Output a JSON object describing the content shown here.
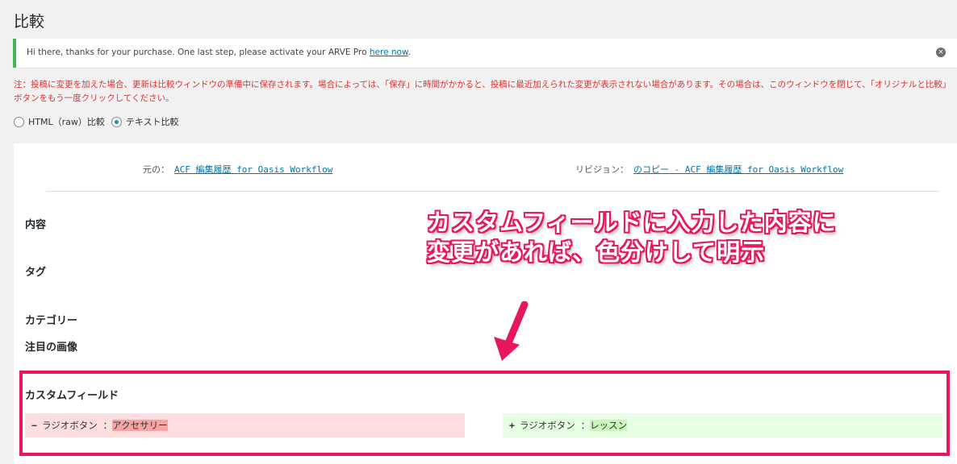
{
  "page": {
    "title": "比較"
  },
  "notice": {
    "text": "Hi there, thanks for your purchase. One last step, please activate your ARVE Pro ",
    "link": "here now",
    "link_suffix": ".",
    "dismiss_icon": "dismiss-icon"
  },
  "warning": {
    "text": "注：投稿に変更を加えた場合、更新は比較ウィンドウの準備中に保存されます。場合によっては、「保存」に時間がかかると、投稿に最近加えられた変更が表示されない場合があります。その場合は、このウィンドウを閉じて、「オリジナルと比較」ボタンをもう一度クリックしてください。"
  },
  "compare_mode": {
    "options": [
      {
        "label": "HTML（raw）比較",
        "selected": false
      },
      {
        "label": "テキスト比較",
        "selected": true
      }
    ]
  },
  "revisions": {
    "original_label": "元の：",
    "original_link": "ACF 編集履歴 for Oasis Workflow",
    "revision_label": "リビジョン：",
    "revision_link": "のコピー - ACF 編集履歴 for Oasis Workflow"
  },
  "fields": {
    "content": "内容",
    "tags": "タグ",
    "categories": "カテゴリー",
    "featured_image": "注目の画像",
    "custom_fields": "カスタムフィールド"
  },
  "annotation": {
    "line1": "カスタムフィールドに入力した内容に",
    "line2": "変更があれば、色分けして明示",
    "color": "#e8175d"
  },
  "diff": {
    "deleted": {
      "sign": "−",
      "key": "ラジオボタン ：",
      "value": "アクセサリー"
    },
    "added": {
      "sign": "+",
      "key": "ラジオボタン ：",
      "value": "レッスン"
    }
  }
}
